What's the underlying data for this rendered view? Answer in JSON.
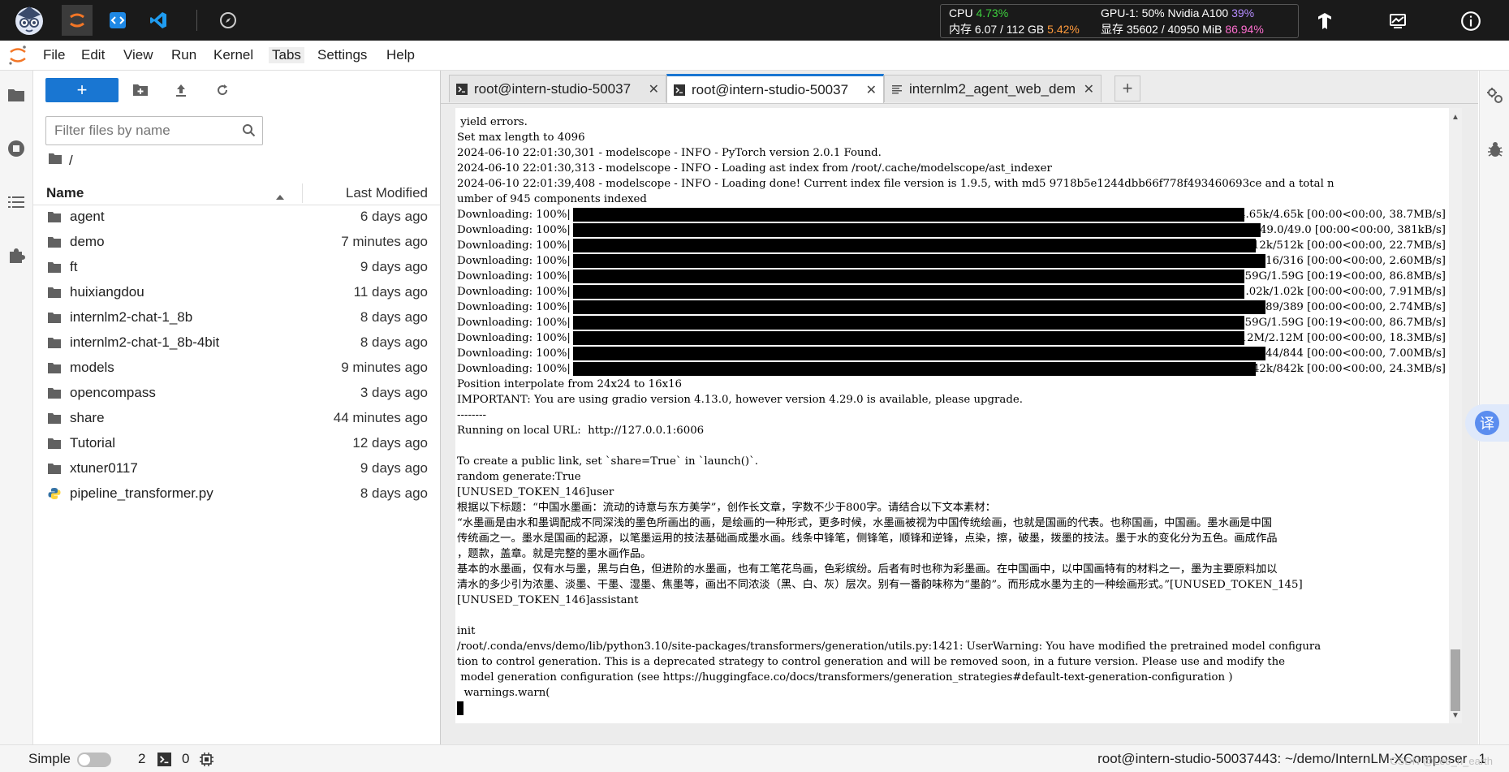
{
  "topbar": {
    "resources": {
      "cpu_label": "CPU",
      "cpu_value": "4.73%",
      "mem_label": "内存 6.07 / 112 GB",
      "mem_value": "5.42%",
      "gpu_label": "GPU-1: 50% Nvidia A100",
      "gpu_value": "39%",
      "vram_label": "显存 35602 / 40950 MiB",
      "vram_value": "86.94%"
    }
  },
  "menu": {
    "items": [
      "File",
      "Edit",
      "View",
      "Run",
      "Kernel",
      "Tabs",
      "Settings",
      "Help"
    ]
  },
  "filebrowser": {
    "new_label": "+",
    "filter_placeholder": "Filter files by name",
    "breadcrumb": "/",
    "col_name": "Name",
    "col_modified": "Last Modified",
    "files": [
      {
        "name": "agent",
        "modified": "6 days ago",
        "type": "folder"
      },
      {
        "name": "demo",
        "modified": "7 minutes ago",
        "type": "folder"
      },
      {
        "name": "ft",
        "modified": "9 days ago",
        "type": "folder"
      },
      {
        "name": "huixiangdou",
        "modified": "11 days ago",
        "type": "folder"
      },
      {
        "name": "internlm2-chat-1_8b",
        "modified": "8 days ago",
        "type": "folder"
      },
      {
        "name": "internlm2-chat-1_8b-4bit",
        "modified": "8 days ago",
        "type": "folder"
      },
      {
        "name": "models",
        "modified": "9 minutes ago",
        "type": "folder"
      },
      {
        "name": "opencompass",
        "modified": "3 days ago",
        "type": "folder"
      },
      {
        "name": "share",
        "modified": "44 minutes ago",
        "type": "folder"
      },
      {
        "name": "Tutorial",
        "modified": "12 days ago",
        "type": "folder"
      },
      {
        "name": "xtuner0117",
        "modified": "9 days ago",
        "type": "folder"
      },
      {
        "name": "pipeline_transformer.py",
        "modified": "8 days ago",
        "type": "python"
      }
    ]
  },
  "tabs": [
    {
      "label": "root@intern-studio-50037",
      "icon": "terminal-icon",
      "active": false
    },
    {
      "label": "root@intern-studio-50037",
      "icon": "terminal-icon",
      "active": true
    },
    {
      "label": "internlm2_agent_web_dem",
      "icon": "text-file-icon",
      "active": false
    }
  ],
  "terminal": {
    "lines_top": [
      " yield errors.",
      "Set max length to 4096",
      "2024-06-10 22:01:30,301 - modelscope - INFO - PyTorch version 2.0.1 Found.",
      "2024-06-10 22:01:30,313 - modelscope - INFO - Loading ast index from /root/.cache/modelscope/ast_indexer",
      "2024-06-10 22:01:39,408 - modelscope - INFO - Loading done! Current index file version is 1.9.5, with md5 9718b5e1244dbb66f778f493460693ce and a total n",
      "umber of 945 components indexed"
    ],
    "downloads": [
      {
        "prefix": "Downloading: 100%|",
        "tail": "| 4.65k/4.65k [00:00<00:00, 38.7MB/s]",
        "progress": 100
      },
      {
        "prefix": "Downloading: 100%|",
        "tail": "| 49.0/49.0 [00:00<00:00, 381kB/s]",
        "progress": 100
      },
      {
        "prefix": "Downloading: 100%|",
        "tail": "| 512k/512k [00:00<00:00, 22.7MB/s]",
        "progress": 100
      },
      {
        "prefix": "Downloading: 100%|",
        "tail": "| 316/316 [00:00<00:00, 2.60MB/s]",
        "progress": 100
      },
      {
        "prefix": "Downloading: 100%|",
        "tail": "| 1.59G/1.59G [00:19<00:00, 86.8MB/s]",
        "progress": 100
      },
      {
        "prefix": "Downloading: 100%|",
        "tail": "| 1.02k/1.02k [00:00<00:00, 7.91MB/s]",
        "progress": 100
      },
      {
        "prefix": "Downloading: 100%|",
        "tail": "| 389/389 [00:00<00:00, 2.74MB/s]",
        "progress": 100
      },
      {
        "prefix": "Downloading: 100%|",
        "tail": "| 1.59G/1.59G [00:19<00:00, 86.7MB/s]",
        "progress": 100
      },
      {
        "prefix": "Downloading: 100%|",
        "tail": "| 2.12M/2.12M [00:00<00:00, 18.3MB/s]",
        "progress": 100
      },
      {
        "prefix": "Downloading: 100%|",
        "tail": "| 844/844 [00:00<00:00, 7.00MB/s]",
        "progress": 100
      },
      {
        "prefix": "Downloading: 100%|",
        "tail": "| 842k/842k [00:00<00:00, 24.3MB/s]",
        "progress": 100
      }
    ],
    "lines_bottom": [
      "Position interpolate from 24x24 to 16x16",
      "IMPORTANT: You are using gradio version 4.13.0, however version 4.29.0 is available, please upgrade.",
      "--------",
      "Running on local URL:  http://127.0.0.1:6006",
      "",
      "To create a public link, set `share=True` in `launch()`.",
      "random generate:True",
      "[UNUSED_TOKEN_146]user",
      "根据以下标题：“中国水墨画：流动的诗意与东方美学”，创作长文章，字数不少于800字。请结合以下文本素材：",
      "“水墨画是由水和墨调配成不同深浅的墨色所画出的画，是绘画的一种形式，更多时候，水墨画被视为中国传统绘画，也就是国画的代表。也称国画，中国画。墨水画是中国",
      "传统画之一。墨水是国画的起源，以笔墨运用的技法基础画成墨水画。线条中锋笔，侧锋笔，顺锋和逆锋，点染，擦，破墨，拨墨的技法。墨于水的变化分为五色。画成作品",
      "，题款，盖章。就是完整的墨水画作品。",
      "基本的水墨画，仅有水与墨，黑与白色，但进阶的水墨画，也有工笔花鸟画，色彩缤纷。后者有时也称为彩墨画。在中国画中，以中国画特有的材料之一，墨为主要原料加以",
      "清水的多少引为浓墨、淡墨、干墨、湿墨、焦墨等，画出不同浓淡（黑、白、灰）层次。别有一番韵味称为“墨韵”。而形成水墨为主的一种绘画形式。”[UNUSED_TOKEN_145]",
      "[UNUSED_TOKEN_146]assistant",
      "",
      "init",
      "/root/.conda/envs/demo/lib/python3.10/site-packages/transformers/generation/utils.py:1421: UserWarning: You have modified the pretrained model configura",
      "tion to control generation. This is a deprecated strategy to control generation and will be removed soon, in a future version. Please use and modify the",
      " model generation configuration (see https://huggingface.co/docs/transformers/generation_strategies#default-text-generation-configuration )",
      "  warnings.warn("
    ]
  },
  "translate_label": "译",
  "statusbar": {
    "mode_label": "Simple",
    "kernels_count": "2",
    "terminals_count": "0",
    "path": "root@intern-studio-50037443: ~/demo/InternLM-XComposer",
    "line_info": "1",
    "watermark": "CSDN @Leo_n_earth"
  }
}
